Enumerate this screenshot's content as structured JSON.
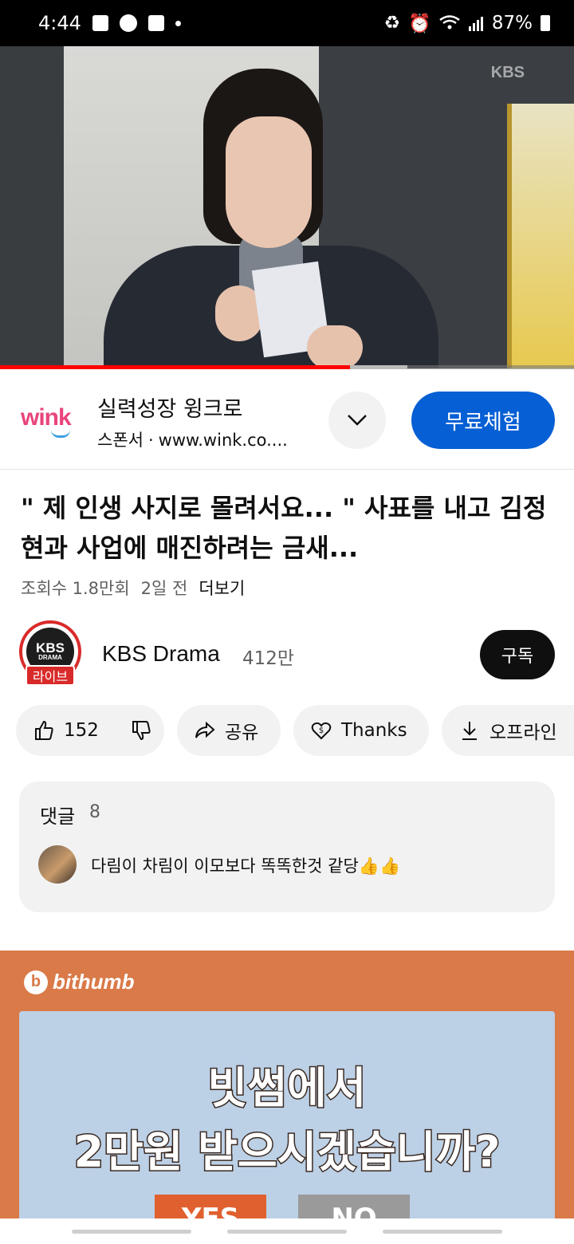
{
  "status_bar": {
    "time": "4:44",
    "battery": "87%",
    "icons": [
      "gallery-icon",
      "c-app-icon",
      "dashboard-icon",
      "dot-icon",
      "recycle-icon",
      "alarm-icon",
      "wifi-icon",
      "signal-icon",
      "battery-icon"
    ]
  },
  "video": {
    "watermark": "KBS",
    "progress_fraction": 0.61,
    "buffered_fraction": 0.71
  },
  "ad": {
    "logo_text": "wink",
    "title": "실력성장 윙크로",
    "sponsor_label": "스폰서",
    "separator": "·",
    "url": "www.wink.co....",
    "cta_label": "무료체험",
    "accent_color": "#065fd4"
  },
  "title": {
    "text": "\" 제 인생 사지로 몰려서요... \" 사표를 내고 김정현과 사업에 매진하려는 금새..."
  },
  "meta": {
    "views": "조회수 1.8만회",
    "age": "2일 전",
    "more": "더보기"
  },
  "channel": {
    "avatar_text": "KBS",
    "avatar_subtext": "DRAMA",
    "live_badge": "라이브",
    "name": "KBS Drama",
    "subscribers": "412만",
    "subscribe_label": "구독"
  },
  "actions": {
    "likes": "152",
    "share": "공유",
    "thanks": "Thanks",
    "offline": "오프라인"
  },
  "comments": {
    "header": "댓글",
    "count": "8",
    "top_comment": "다림이 차림이 이모보다 똑똑한것 같당👍👍"
  },
  "banner_ad": {
    "brand": "bithumb",
    "line1": "빗썸에서",
    "line2": "2만원 받으시겠습니까?",
    "yes": "YES",
    "no": "NO",
    "brand_color": "#d97a48"
  }
}
